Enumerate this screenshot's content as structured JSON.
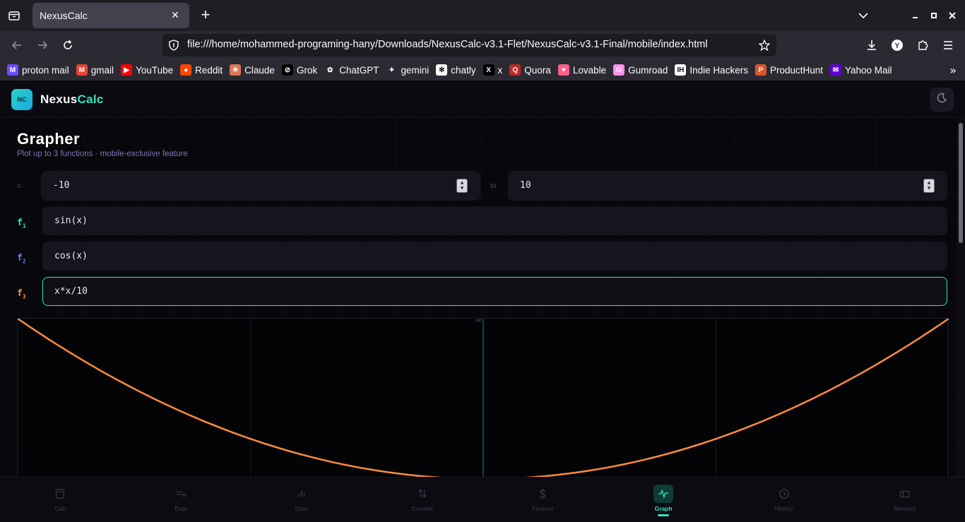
{
  "browser": {
    "tab_title": "NexusCalc",
    "url": "file:///home/mohammed-programing-hany/Downloads/NexusCalc-v3.1-Flet/NexusCalc-v3.1-Final/mobile/index.html",
    "bookmarks": [
      {
        "label": "proton mail",
        "icon": "proton-mail-icon",
        "color": "#6d4aff",
        "glyph": "M"
      },
      {
        "label": "gmail",
        "icon": "gmail-icon",
        "color": "#ea4335",
        "glyph": "M"
      },
      {
        "label": "YouTube",
        "icon": "youtube-icon",
        "color": "#ff0000",
        "glyph": "▶"
      },
      {
        "label": "Reddit",
        "icon": "reddit-icon",
        "color": "#ff4500",
        "glyph": "●"
      },
      {
        "label": "Claude",
        "icon": "claude-icon",
        "color": "#d97757",
        "glyph": "✳"
      },
      {
        "label": "Grok",
        "icon": "grok-icon",
        "color": "#000000",
        "glyph": "⊘"
      },
      {
        "label": "ChatGPT",
        "icon": "chatgpt-icon",
        "color": "#2b2a33",
        "glyph": "✿"
      },
      {
        "label": "gemini",
        "icon": "gemini-icon",
        "color": "#2b2a33",
        "glyph": "✦"
      },
      {
        "label": "chatly",
        "icon": "chatly-icon",
        "color": "#ffffff",
        "glyph": "✻"
      },
      {
        "label": "x",
        "icon": "x-icon",
        "color": "#000000",
        "glyph": "X"
      },
      {
        "label": "Quora",
        "icon": "quora-icon",
        "color": "#b92b27",
        "glyph": "Q"
      },
      {
        "label": "Lovable",
        "icon": "lovable-icon",
        "color": "#ff5e8a",
        "glyph": "♥"
      },
      {
        "label": "Gumroad",
        "icon": "gumroad-icon",
        "color": "#ff90e8",
        "glyph": "G"
      },
      {
        "label": "Indie Hackers",
        "icon": "indie-hackers-icon",
        "color": "#ffffff",
        "glyph": "IH"
      },
      {
        "label": "ProductHunt",
        "icon": "producthunt-icon",
        "color": "#da552f",
        "glyph": "P"
      },
      {
        "label": "Yahoo Mail",
        "icon": "yahoo-mail-icon",
        "color": "#6001d2",
        "glyph": "✉"
      }
    ]
  },
  "app": {
    "logo_badge": "NC",
    "logo_part1": "Nexus",
    "logo_part2": "Calc",
    "accent": "#2ee6c4"
  },
  "grapher": {
    "title": "Grapher",
    "subtitle": "Plot up to 3 functions · mobile-exclusive feature",
    "range_label": "x:",
    "to_label": "to",
    "x_min": "-10",
    "x_max": "10",
    "functions": [
      {
        "label": "f",
        "sub": "1",
        "expr": "sin(x)",
        "color": "#2ee6c4"
      },
      {
        "label": "f",
        "sub": "2",
        "expr": "cos(x)",
        "color": "#6b7bff"
      },
      {
        "label": "f",
        "sub": "3",
        "expr": "x*x/10",
        "color": "#ff8c3a"
      }
    ],
    "y_axis_top_label": "10"
  },
  "chart_data": {
    "type": "line",
    "title": "",
    "xlabel": "",
    "ylabel": "",
    "xlim": [
      -10,
      10
    ],
    "ylim": [
      -10,
      10
    ],
    "series": [
      {
        "expr": "x*x/10",
        "color": "#ff8c3a",
        "x": [
          -10,
          -8,
          -6,
          -4,
          -2,
          0,
          2,
          4,
          6,
          8,
          10
        ],
        "values": [
          10,
          6.4,
          3.6,
          1.6,
          0.4,
          0,
          0.4,
          1.6,
          3.6,
          6.4,
          10
        ]
      }
    ],
    "grid": true,
    "y_tick_labels": [
      "10"
    ]
  },
  "bottom_nav": [
    {
      "label": "Calc",
      "icon": "calculator-icon",
      "active": false
    },
    {
      "label": "Expr",
      "icon": "expression-icon",
      "active": false
    },
    {
      "label": "Stats",
      "icon": "bar-chart-icon",
      "active": false
    },
    {
      "label": "Convert",
      "icon": "swap-arrows-icon",
      "active": false
    },
    {
      "label": "Finance",
      "icon": "dollar-icon",
      "active": false
    },
    {
      "label": "Graph",
      "icon": "pulse-icon",
      "active": true
    },
    {
      "label": "History",
      "icon": "clock-icon",
      "active": false
    },
    {
      "label": "Memory",
      "icon": "memory-card-icon",
      "active": false
    }
  ]
}
